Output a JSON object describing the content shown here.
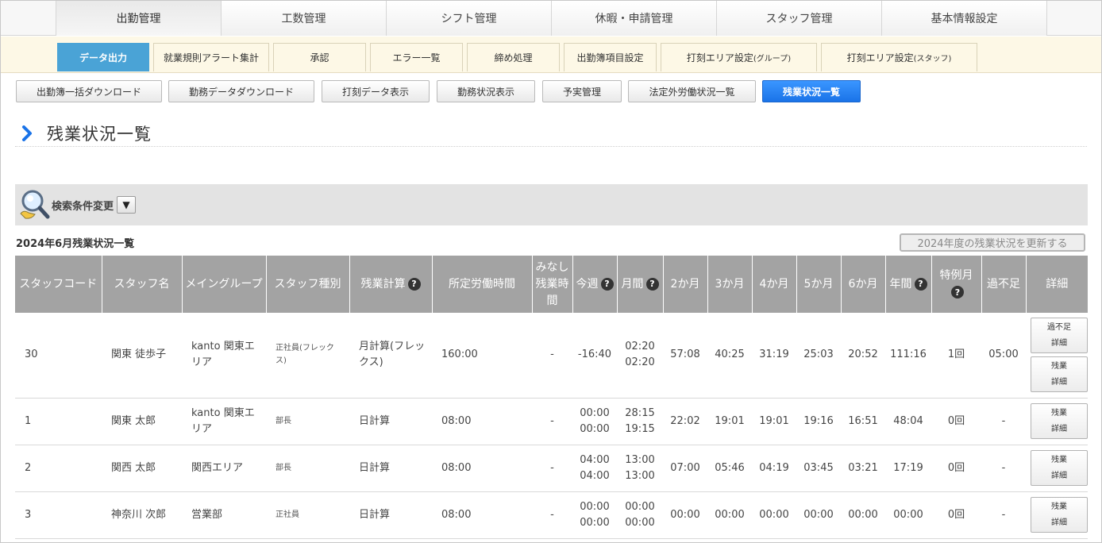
{
  "main_nav": {
    "tabs": [
      {
        "label": "出勤管理",
        "active": true
      },
      {
        "label": "工数管理",
        "active": false
      },
      {
        "label": "シフト管理",
        "active": false
      },
      {
        "label": "休暇・申請管理",
        "active": false
      },
      {
        "label": "スタッフ管理",
        "active": false
      },
      {
        "label": "基本情報設定",
        "active": false
      }
    ]
  },
  "sub_nav": {
    "tabs": [
      {
        "label": "データ出力",
        "active": true
      },
      {
        "label": "就業規則アラート集計"
      },
      {
        "label": "承認"
      },
      {
        "label": "エラー一覧"
      },
      {
        "label": "締め処理"
      },
      {
        "label": "出勤簿項目設定"
      },
      {
        "label": "打刻エリア設定",
        "suffix": "(グループ)"
      },
      {
        "label": "打刻エリア設定",
        "suffix": "(スタッフ)"
      }
    ]
  },
  "toolbar": {
    "buttons": [
      {
        "label": "出勤簿一括ダウンロード"
      },
      {
        "label": "勤務データダウンロード"
      },
      {
        "label": "打刻データ表示"
      },
      {
        "label": "勤務状況表示"
      },
      {
        "label": "予実管理"
      },
      {
        "label": "法定外労働状況一覧"
      },
      {
        "label": "残業状況一覧",
        "active": true
      }
    ]
  },
  "page": {
    "title": "残業状況一覧",
    "search_label": "検索条件変更",
    "toggle_icon": "▼",
    "subtitle": "2024年6月残業状況一覧",
    "update_button": "2024年度の残業状況を更新する"
  },
  "table": {
    "headers": {
      "code": "スタッフコード",
      "name": "スタッフ名",
      "group": "メイングループ",
      "type": "スタッフ種別",
      "calc": "残業計算",
      "standard": "所定労働時間",
      "deemed_1": "みなし",
      "deemed_2": "残業時",
      "deemed_3": "間",
      "week": "今週",
      "month": "月間",
      "m2": "2か月",
      "m3": "3か月",
      "m4": "4か月",
      "m5": "5か月",
      "m6": "6か月",
      "year": "年間",
      "special": "特例月",
      "excess": "過不足",
      "detail": "詳細",
      "help": "?"
    },
    "rows": [
      {
        "code": "30",
        "name": "関東 徒歩子",
        "group": "kanto 関東エリア",
        "type": "正社員(フレックス)",
        "calc": "月計算(フレックス)",
        "standard": "160:00",
        "deemed": "-",
        "week": "-16:40",
        "week2": "",
        "month": "02:20",
        "month2": "02:20",
        "m2": "57:08",
        "m3": "40:25",
        "m4": "31:19",
        "m5": "25:03",
        "m6": "20:52",
        "year": "111:16",
        "special": "1回",
        "excess": "05:00",
        "btn1a": "過不足",
        "btn1b": "詳細",
        "btn2a": "残業",
        "btn2b": "詳細"
      },
      {
        "code": "1",
        "name": "関東 太郎",
        "group": "kanto 関東エリア",
        "type": "部長",
        "calc": "日計算",
        "standard": "08:00",
        "deemed": "-",
        "week": "00:00",
        "week2": "00:00",
        "month": "28:15",
        "month2": "19:15",
        "m2": "22:02",
        "m3": "19:01",
        "m4": "19:01",
        "m5": "19:16",
        "m6": "16:51",
        "year": "48:04",
        "special": "0回",
        "excess": "-",
        "btn2a": "残業",
        "btn2b": "詳細"
      },
      {
        "code": "2",
        "name": "関西 太郎",
        "group": "関西エリア",
        "type": "部長",
        "calc": "日計算",
        "standard": "08:00",
        "deemed": "-",
        "week": "04:00",
        "week2": "04:00",
        "month": "13:00",
        "month2": "13:00",
        "m2": "07:00",
        "m3": "05:46",
        "m4": "04:19",
        "m5": "03:45",
        "m6": "03:21",
        "year": "17:19",
        "special": "0回",
        "excess": "-",
        "btn2a": "残業",
        "btn2b": "詳細"
      },
      {
        "code": "3",
        "name": "神奈川 次郎",
        "group": "営業部",
        "type": "正社員",
        "calc": "日計算",
        "standard": "08:00",
        "deemed": "-",
        "week": "00:00",
        "week2": "00:00",
        "month": "00:00",
        "month2": "00:00",
        "m2": "00:00",
        "m3": "00:00",
        "m4": "00:00",
        "m5": "00:00",
        "m6": "00:00",
        "year": "00:00",
        "special": "0回",
        "excess": "-",
        "btn2a": "残業",
        "btn2b": "詳細"
      }
    ]
  },
  "icons": {
    "chevron": "chevron-right-icon",
    "search": "magnifier-icon",
    "help": "question-circle-icon"
  },
  "colors": {
    "accent_blue": "#1a73e8",
    "subnav_active": "#4aa3d6",
    "table_header": "#a3a3a3"
  }
}
